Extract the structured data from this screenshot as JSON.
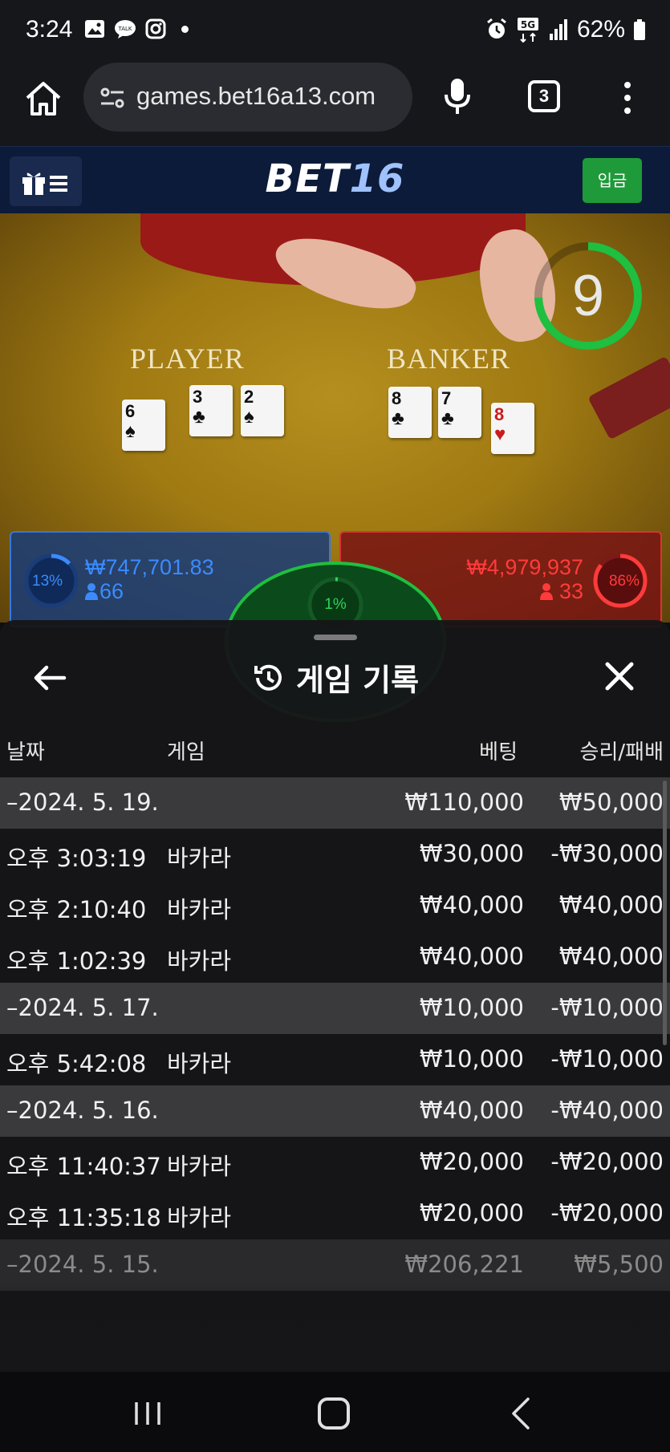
{
  "status_bar": {
    "time": "3:24",
    "network": "5G",
    "battery": "62%",
    "icons_left": [
      "gallery-icon",
      "talk-icon",
      "instagram-icon",
      "dot"
    ],
    "icons_right": [
      "alarm-icon",
      "5g-icon",
      "signal-icon",
      "battery-icon"
    ]
  },
  "browser": {
    "url": "games.bet16a13.com",
    "tab_count": "3"
  },
  "site": {
    "logo_bet": "BET",
    "logo_num": "16",
    "deposit_label": "입금"
  },
  "game": {
    "timer": "9",
    "player_label": "PLAYER",
    "banker_label": "BANKER",
    "player_cards": [
      {
        "rank": "6",
        "suit": "♠",
        "red": false
      },
      {
        "rank": "3",
        "suit": "♣",
        "red": false
      },
      {
        "rank": "2",
        "suit": "♠",
        "red": false
      }
    ],
    "banker_cards": [
      {
        "rank": "8",
        "suit": "♣",
        "red": false
      },
      {
        "rank": "7",
        "suit": "♣",
        "red": false
      },
      {
        "rank": "8",
        "suit": "♥",
        "red": true
      }
    ],
    "player_pct": "13%",
    "player_amount": "₩747,701.83",
    "player_count": "66",
    "banker_pct": "86%",
    "banker_amount": "₩4,979,937",
    "banker_count": "33",
    "tie_pct": "1%",
    "colors": {
      "player": "#3b8bff",
      "banker": "#ff3b3b",
      "tie": "#2ed35a"
    }
  },
  "history": {
    "title": "게임 기록",
    "columns": {
      "date": "날짜",
      "game": "게임",
      "bet": "베팅",
      "result": "승리/패배"
    },
    "rows": [
      {
        "type": "date",
        "date": "–2024. 5. 19.",
        "game": "",
        "bet": "₩110,000",
        "result": "₩50,000"
      },
      {
        "type": "item",
        "date": "오후 3:03:19",
        "game": "바카라",
        "bet": "₩30,000",
        "result": "-₩30,000"
      },
      {
        "type": "item",
        "date": "오후 2:10:40",
        "game": "바카라",
        "bet": "₩40,000",
        "result": "₩40,000"
      },
      {
        "type": "item",
        "date": "오후 1:02:39",
        "game": "바카라",
        "bet": "₩40,000",
        "result": "₩40,000"
      },
      {
        "type": "date",
        "date": "–2024. 5. 17.",
        "game": "",
        "bet": "₩10,000",
        "result": "-₩10,000"
      },
      {
        "type": "item",
        "date": "오후 5:42:08",
        "game": "바카라",
        "bet": "₩10,000",
        "result": "-₩10,000"
      },
      {
        "type": "date",
        "date": "–2024. 5. 16.",
        "game": "",
        "bet": "₩40,000",
        "result": "-₩40,000"
      },
      {
        "type": "item",
        "date": "오후 11:40:37",
        "game": "바카라",
        "bet": "₩20,000",
        "result": "-₩20,000"
      },
      {
        "type": "item",
        "date": "오후 11:35:18",
        "game": "바카라",
        "bet": "₩20,000",
        "result": "-₩20,000"
      },
      {
        "type": "date",
        "date": "–2024. 5. 15.",
        "game": "",
        "bet": "₩206,221",
        "result": "₩5,500"
      }
    ]
  }
}
